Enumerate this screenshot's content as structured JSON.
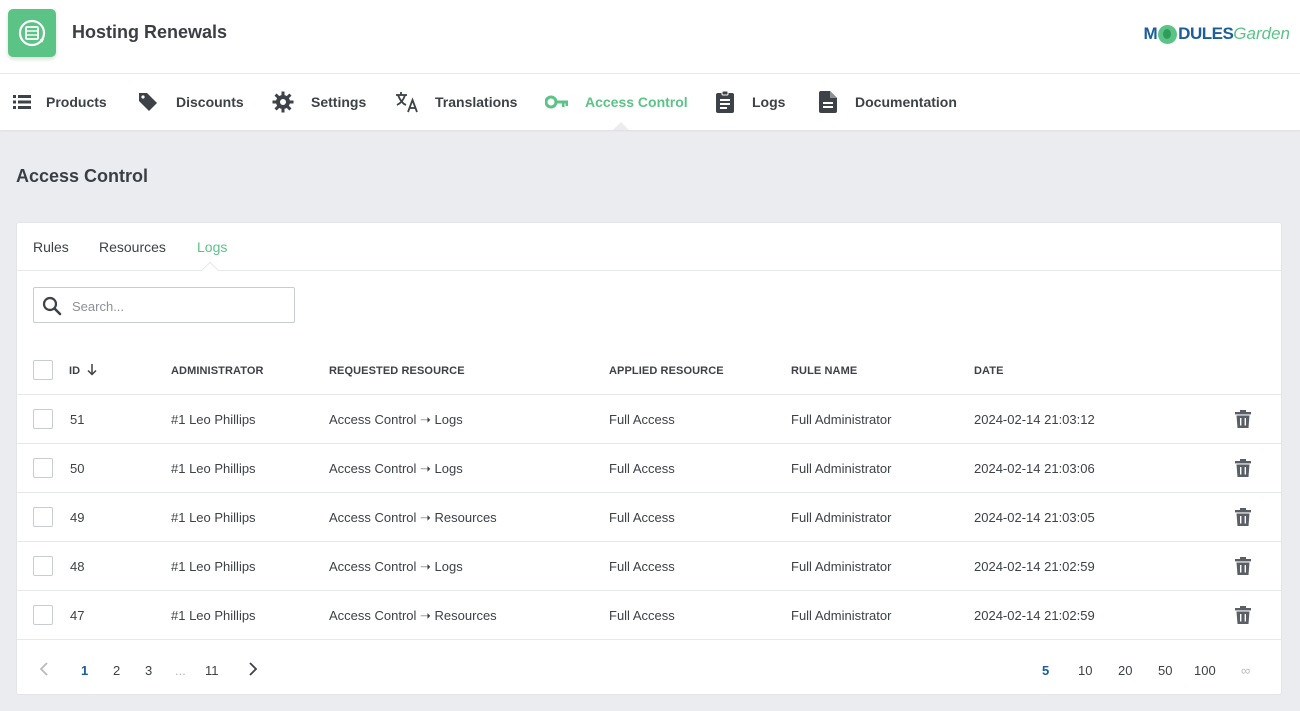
{
  "header": {
    "app_title": "Hosting Renewals",
    "brand_left": "M",
    "brand_mid": "DULES",
    "brand_right": "Garden"
  },
  "nav": {
    "items": [
      {
        "label": "Products",
        "icon": "list-icon"
      },
      {
        "label": "Discounts",
        "icon": "tag-icon"
      },
      {
        "label": "Settings",
        "icon": "gear-icon"
      },
      {
        "label": "Translations",
        "icon": "translate-icon"
      },
      {
        "label": "Access Control",
        "icon": "key-icon",
        "active": true
      },
      {
        "label": "Logs",
        "icon": "clipboard-icon"
      },
      {
        "label": "Documentation",
        "icon": "document-icon"
      }
    ]
  },
  "page": {
    "title": "Access Control"
  },
  "tabs": [
    {
      "label": "Rules"
    },
    {
      "label": "Resources"
    },
    {
      "label": "Logs",
      "active": true
    }
  ],
  "search": {
    "placeholder": "Search...",
    "value": ""
  },
  "table": {
    "columns": [
      "ID",
      "ADMINISTRATOR",
      "REQUESTED RESOURCE",
      "APPLIED RESOURCE",
      "RULE NAME",
      "DATE"
    ],
    "rows": [
      {
        "id": "51",
        "administrator": "#1 Leo Phillips",
        "requested": "Access Control ➝ Logs",
        "applied": "Full Access",
        "rule": "Full Administrator",
        "date": "2024-02-14 21:03:12"
      },
      {
        "id": "50",
        "administrator": "#1 Leo Phillips",
        "requested": "Access Control ➝ Logs",
        "applied": "Full Access",
        "rule": "Full Administrator",
        "date": "2024-02-14 21:03:06"
      },
      {
        "id": "49",
        "administrator": "#1 Leo Phillips",
        "requested": "Access Control ➝ Resources",
        "applied": "Full Access",
        "rule": "Full Administrator",
        "date": "2024-02-14 21:03:05"
      },
      {
        "id": "48",
        "administrator": "#1 Leo Phillips",
        "requested": "Access Control ➝ Logs",
        "applied": "Full Access",
        "rule": "Full Administrator",
        "date": "2024-02-14 21:02:59"
      },
      {
        "id": "47",
        "administrator": "#1 Leo Phillips",
        "requested": "Access Control ➝ Resources",
        "applied": "Full Access",
        "rule": "Full Administrator",
        "date": "2024-02-14 21:02:59"
      }
    ]
  },
  "pagination": {
    "pages": [
      "1",
      "2",
      "3",
      "...",
      "11"
    ],
    "current_page": "1",
    "page_sizes": [
      "5",
      "10",
      "20",
      "50",
      "100",
      "∞"
    ],
    "current_size": "5"
  },
  "colors": {
    "accent": "#5cc387",
    "brand_blue": "#1b5e9b",
    "background": "#ebecf0"
  }
}
